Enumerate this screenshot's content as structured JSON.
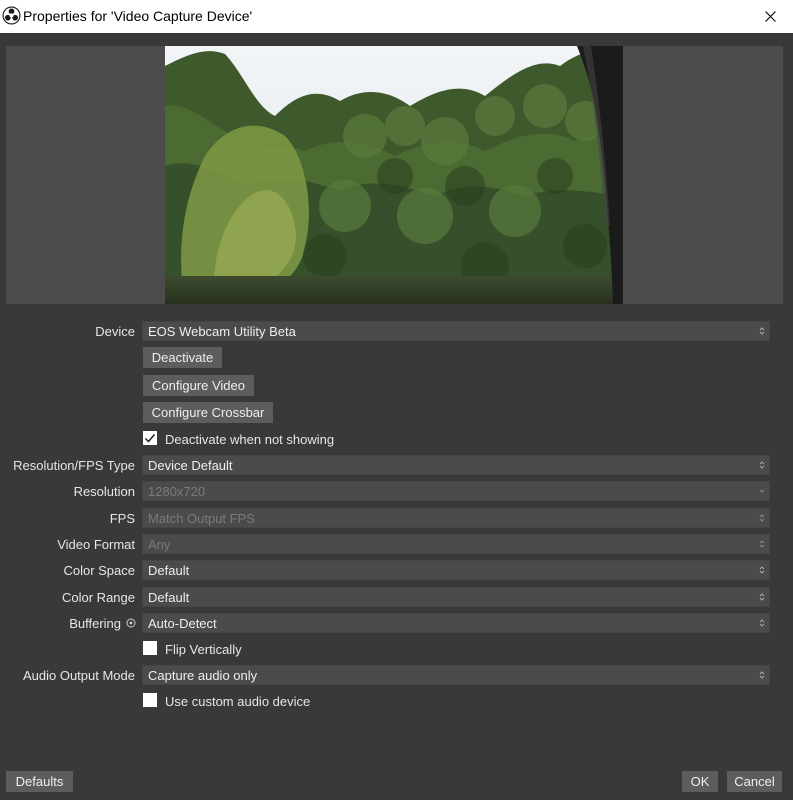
{
  "window": {
    "title": "Properties for 'Video Capture Device'",
    "app_icon": "obs-logo-icon",
    "close_icon": "close-icon"
  },
  "preview": {
    "description_icon": "camera-preview-image"
  },
  "device": {
    "label": "Device",
    "value": "EOS Webcam Utility Beta"
  },
  "buttons": {
    "deactivate": "Deactivate",
    "configure_video": "Configure Video",
    "configure_crossbar": "Configure Crossbar",
    "defaults": "Defaults",
    "ok": "OK",
    "cancel": "Cancel"
  },
  "deactivate_when_not_showing": {
    "label": "Deactivate when not showing",
    "checked": true
  },
  "resolution_fps_type": {
    "label": "Resolution/FPS Type",
    "value": "Device Default"
  },
  "resolution": {
    "label": "Resolution",
    "value": "1280x720",
    "enabled": false
  },
  "fps": {
    "label": "FPS",
    "value": "Match Output FPS",
    "enabled": false
  },
  "video_format": {
    "label": "Video Format",
    "value": "Any",
    "enabled": false
  },
  "color_space": {
    "label": "Color Space",
    "value": "Default"
  },
  "color_range": {
    "label": "Color Range",
    "value": "Default"
  },
  "buffering": {
    "label": "Buffering",
    "value": "Auto-Detect",
    "info_icon": "info-icon"
  },
  "flip_vertically": {
    "label": "Flip Vertically",
    "checked": false
  },
  "audio_output_mode": {
    "label": "Audio Output Mode",
    "value": "Capture audio only"
  },
  "use_custom_audio_device": {
    "label": "Use custom audio device",
    "checked": false
  },
  "colors": {
    "background": "#3a3939",
    "preview_bg": "#4c4c4c",
    "combo_bg": "#4b4b4b",
    "button_bg": "#5d5d5d",
    "text": "#e6e6e6",
    "disabled_text": "#7a7a7a"
  }
}
